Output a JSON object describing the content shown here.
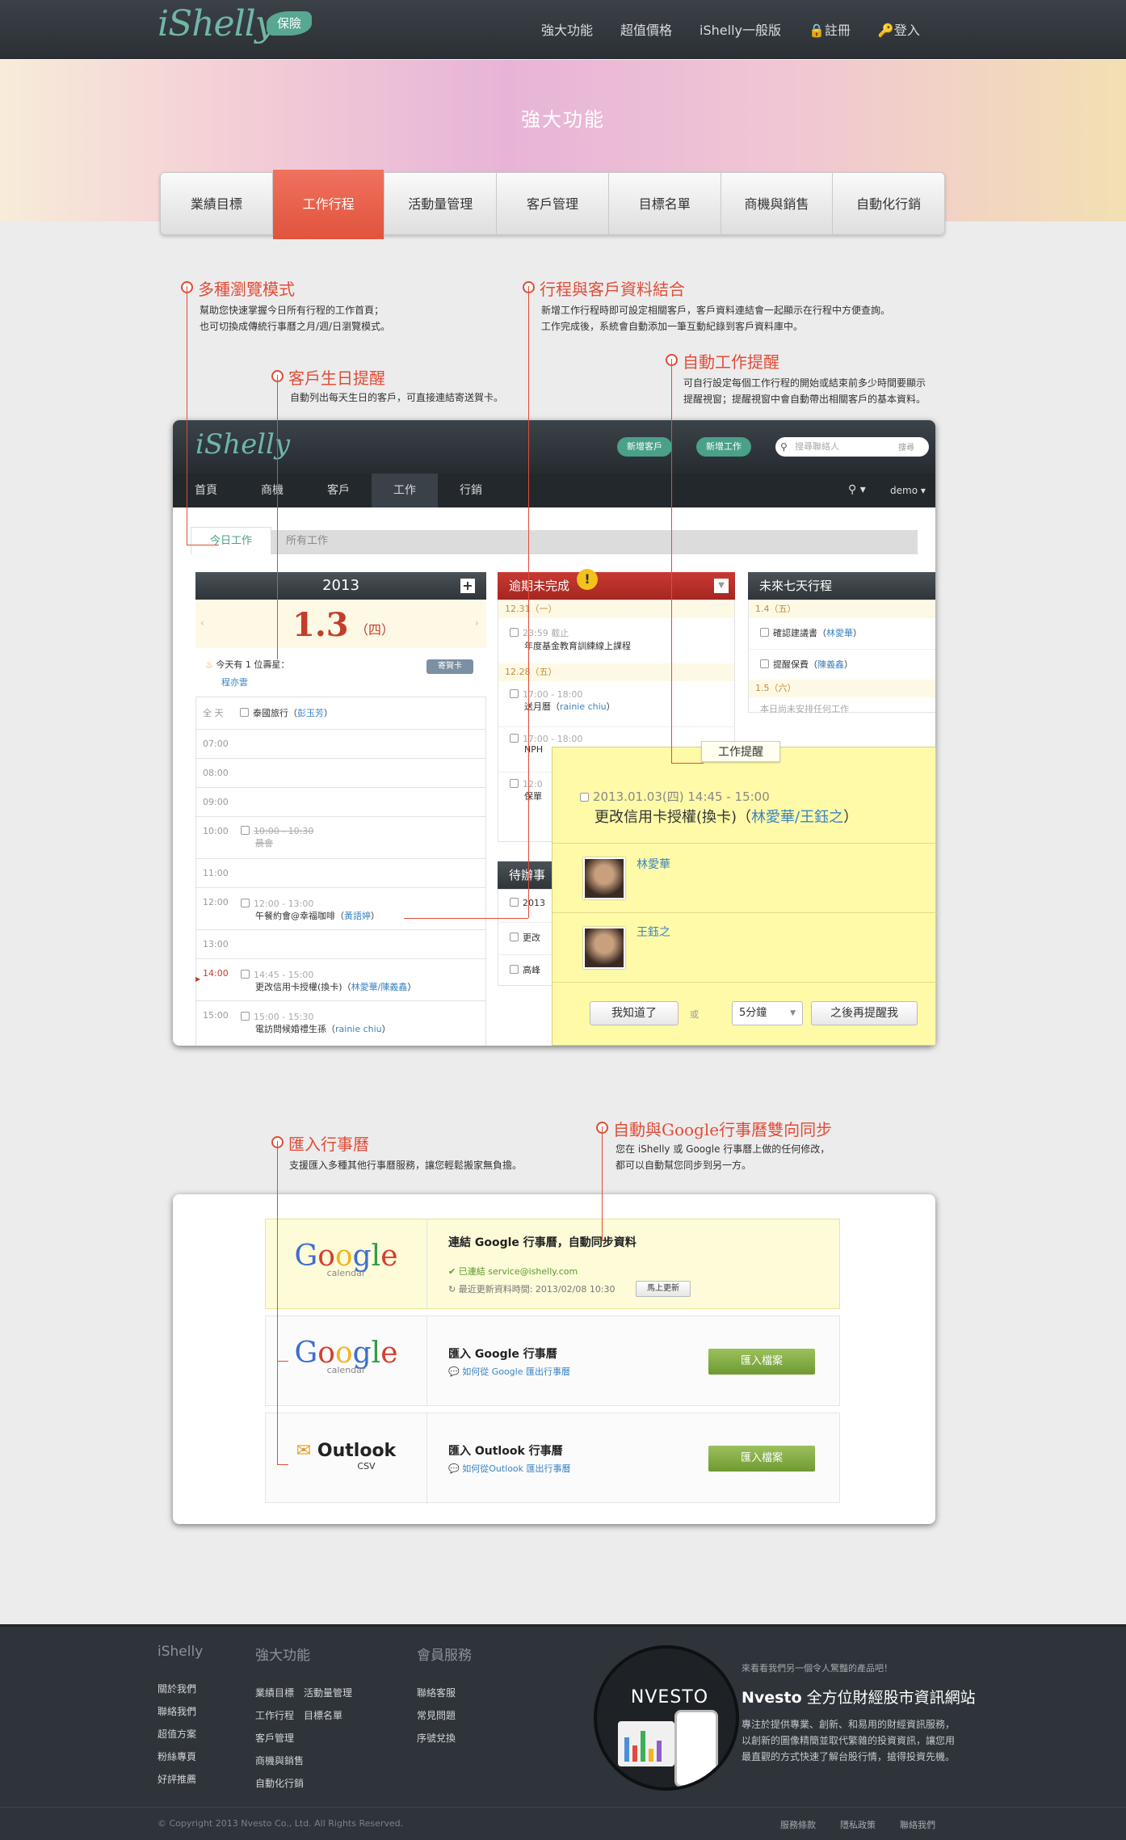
{
  "header": {
    "logo": "iShelly",
    "badge": "保險",
    "nav": [
      "強大功能",
      "超值價格",
      "iShelly一般版",
      "註冊",
      "登入"
    ]
  },
  "hero": {
    "title": "強大功能",
    "tabs": [
      "業績目標",
      "工作行程",
      "活動量管理",
      "客戶管理",
      "目標名單",
      "商機與銷售",
      "自動化行銷"
    ],
    "active_tab": 1
  },
  "annotations": {
    "multi_view": {
      "title": "多種瀏覽模式",
      "text1": "幫助您快速掌握今日所有行程的工作首頁；",
      "text2": "也可切換成傳統行事曆之月/週/日瀏覽模式。"
    },
    "combine": {
      "title": "行程與客戶資料結合",
      "text1": "新增工作行程時即可設定相關客戶，客戶資料連結會一起顯示在行程中方便查詢。",
      "text2": "工作完成後，系統會自動添加一筆互動紀錄到客戶資料庫中。"
    },
    "birthday": {
      "title": "客戶生日提醒",
      "text1": "自動列出每天生日的客戶，可直接連結寄送賀卡。"
    },
    "reminder": {
      "title": "自動工作提醒",
      "text1": "可自行設定每個工作行程的開始或結束前多少時間要顯示",
      "text2": "提醒視窗；提醒視窗中會自動帶出相關客戶的基本資料。"
    },
    "import": {
      "title": "匯入行事曆",
      "text1": "支援匯入多種其他行事曆服務，讓您輕鬆搬家無負擔。"
    },
    "google_sync": {
      "title": "自動與Google行事曆雙向同步",
      "text1": "您在 iShelly 或 Google 行事曆上做的任何修改，",
      "text2": "都可以自動幫您同步到另一方。"
    }
  },
  "app": {
    "logo": "iShelly",
    "btn_add_client": "新增客戶",
    "btn_add_task": "新增工作",
    "search_placeholder": "搜尋聯絡人",
    "search_btn": "搜尋",
    "nav": [
      "首頁",
      "商機",
      "客戶",
      "工作",
      "行銷"
    ],
    "active_nav": 3,
    "user": "demo",
    "subtabs": [
      "今日工作",
      "所有工作"
    ],
    "cal": {
      "year": "2013",
      "date": "1.3",
      "weekday": "（四）",
      "birthday_prefix": "今天有",
      "birthday_count": "1",
      "birthday_suffix": "位壽星：",
      "birthday_name": "程亦雲",
      "card_btn": "寄賀卡",
      "allday_label": "全 天",
      "allday_task": "泰國旅行（",
      "allday_person": "彭玉芳",
      "allday_end": "）",
      "times": [
        "07:00",
        "08:00",
        "09:00",
        "10:00",
        "11:00",
        "12:00",
        "13:00",
        "14:00",
        "15:00"
      ],
      "t10_time": "10:00 - 10:30",
      "t10_task": "晨會",
      "t12_time": "12:00 - 13:00",
      "t12_task": "午餐約會@幸福咖啡（",
      "t12_person": "黃語婷",
      "t12_end": "）",
      "t14_time": "14:45 - 15:00",
      "t14_task": "更改信用卡授權(換卡)（",
      "t14_p1": "林愛華",
      "t14_sep": "/",
      "t14_p2": "陳義鑫",
      "t14_end": "）",
      "t15_time": "15:00 - 15:30",
      "t15_task": "電訪問候婚禮生孫（",
      "t15_person": "rainie chiu",
      "t15_end": "）"
    },
    "overdue": {
      "title": "逾期未完成",
      "d1": "12.31（一）",
      "d1_time": "23:59 截止",
      "d1_task": "年度基金教育訓練線上課程",
      "d2": "12.28（五）",
      "d2_time": "17:00 - 18:00",
      "d2_task": "送月曆（",
      "d2_person": "rainie chiu",
      "d2_end": "）",
      "d3_time": "17:00 - 18:00",
      "d3_task": "NPH",
      "d4_time": "12:0",
      "d4_task": "保單"
    },
    "pending": {
      "title": "待辦事",
      "i1": "2013",
      "i2": "更改",
      "i3": "高峰"
    },
    "next7": {
      "title": "未來七天行程",
      "d1": "1.4（五）",
      "t1": "確認建議書（",
      "p1": "林愛華",
      "t2": "提醒保費（",
      "p2": "陳義鑫",
      "end": "）",
      "d2": "1.5（六）",
      "empty": "本日尚未安排任何工作"
    },
    "popup": {
      "label": "工作提醒",
      "datetime": "2013.01.03(四)  14:45 - 15:00",
      "task": "更改信用卡授權(換卡)（",
      "p1": "林愛華",
      "sep": "/",
      "p2": "王鈺之",
      "end": "）",
      "person1": "林愛華",
      "person2": "王鈺之",
      "ok_btn": "我知道了",
      "or": "或",
      "snooze": "5分鐘",
      "remind_btn": "之後再提醒我"
    }
  },
  "import_panel": {
    "google_sync": {
      "logo": "Google",
      "logo_sub": "calendar",
      "title": "連結 Google 行事曆，自動同步資料",
      "status": "已連結 service@ishelly.com",
      "updated": "最近更新資料時間: 2013/02/08 10:30",
      "update_btn": "馬上更新"
    },
    "google_import": {
      "logo": "Google",
      "logo_sub": "calendar",
      "title": "匯入 Google 行事曆",
      "help_prefix": "如何從 Google ",
      "help_link": "匯出行事曆",
      "btn": "匯入檔案"
    },
    "outlook_import": {
      "logo": "Outlook",
      "logo_sub": "CSV",
      "title": "匯入 Outlook 行事曆",
      "help_prefix": "如何從Outlook ",
      "help_link": "匯出行事曆",
      "btn": "匯入檔案"
    }
  },
  "footer": {
    "col1": {
      "title": "iShelly",
      "items": [
        "關於我們",
        "聯絡我們",
        "超值方案",
        "粉絲專頁",
        "好評推薦"
      ]
    },
    "col2": {
      "title": "強大功能",
      "items": [
        "業績目標",
        "活動量管理",
        "工作行程",
        "目標名單",
        "客戶管理",
        "商機與銷售",
        "自動化行銷"
      ]
    },
    "col3": {
      "title": "會員服務",
      "items": [
        "聯絡客服",
        "常見問題",
        "序號兌換"
      ]
    },
    "promo": {
      "small": "來看看我們另一個令人驚豔的產品吧！",
      "brand": "Nvesto",
      "title": " 全方位財經股市資訊網站",
      "desc1": "專注於提供專業、創新、和易用的財經資訊服務，",
      "desc2": "以創新的圖像精簡並取代繁雜的投資資訊，讓您用",
      "desc3": "最直觀的方式快速了解台股行情，搶得投資先機。",
      "logo": "NVESTO"
    },
    "copyright": "© Copyright 2013 Nvesto Co., Ltd. All Rights Reserved.",
    "links": [
      "服務條款",
      "隱私政策",
      "聯絡我們"
    ]
  }
}
